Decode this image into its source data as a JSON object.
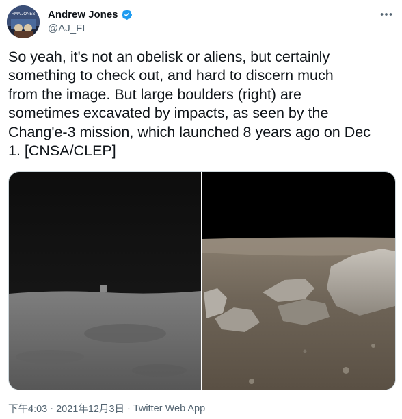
{
  "author": {
    "display_name": "Andrew Jones",
    "handle": "@AJ_FI",
    "avatar_text": "HMA JONES",
    "verified": true
  },
  "tweet": {
    "text": "So yeah, it's not an obelisk or aliens, but certainly\nsomething to check out, and hard to discern much\nfrom the image. But large boulders (right) are\nsometimes excavated by impacts, as seen by the\nChang'e-3 mission, which launched 8 years ago on Dec\n1. [CNSA/CLEP]"
  },
  "media": {
    "left_image": "grayscale lunar surface with small cube-like object on horizon",
    "right_image": "color lunar surface with large boulders under black sky"
  },
  "meta": {
    "time": "下午4:03",
    "separator": "·",
    "date": "2021年12月3日",
    "app": "Twitter Web App"
  },
  "colors": {
    "text": "#0f1419",
    "secondary": "#536471",
    "verified": "#1d9bf0",
    "border": "#cfd9de"
  },
  "icons": [
    "verified-badge-icon",
    "more-options-icon"
  ]
}
